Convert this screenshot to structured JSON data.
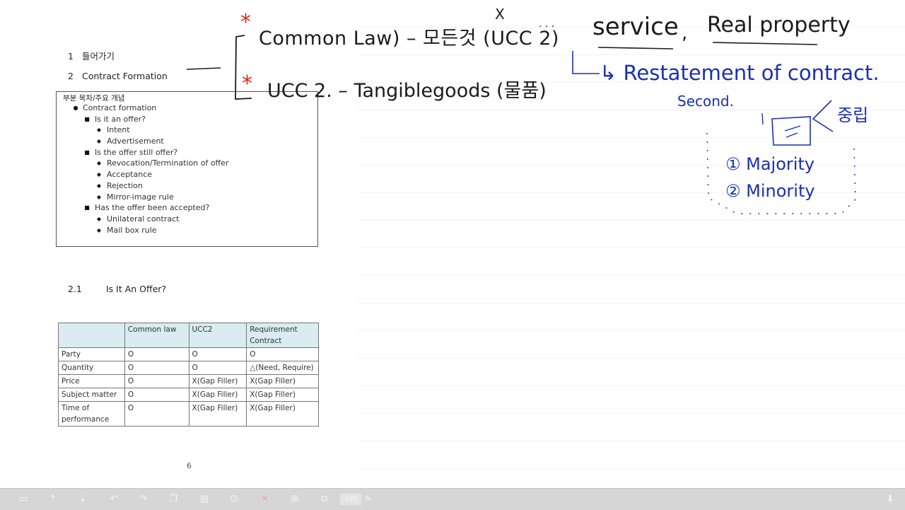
{
  "document": {
    "headings": [
      {
        "num": "1",
        "text": "들어가기"
      },
      {
        "num": "2",
        "text": "Contract Formation"
      }
    ],
    "toc": {
      "title": "부분 목차/주요 개념",
      "items": [
        {
          "level": 1,
          "text": "Contract formation"
        },
        {
          "level": 2,
          "text": "Is it an offer?"
        },
        {
          "level": 3,
          "text": "Intent"
        },
        {
          "level": 3,
          "text": "Advertisement"
        },
        {
          "level": 2,
          "text": "Is the offer still offer?"
        },
        {
          "level": 3,
          "text": "Revocation/Termination of offer"
        },
        {
          "level": 3,
          "text": "Acceptance"
        },
        {
          "level": 3,
          "text": "Rejection"
        },
        {
          "level": 3,
          "text": "Mirror-image rule"
        },
        {
          "level": 2,
          "text": "Has the offer been accepted?"
        },
        {
          "level": 3,
          "text": "Unilateral contract"
        },
        {
          "level": 3,
          "text": "Mail box rule"
        }
      ]
    },
    "section": {
      "num": "2.1",
      "title": "Is It An Offer?"
    },
    "table": {
      "headers": [
        "",
        "Common law",
        "UCC2",
        "Requirement Contract"
      ],
      "rows": [
        [
          "Party",
          "O",
          "O",
          "O"
        ],
        [
          "Quantity",
          "O",
          "O",
          "△(Need, Require)"
        ],
        [
          "Price",
          "O",
          "X(Gap Filler)",
          "X(Gap Filler)"
        ],
        [
          "Subject matter",
          "O",
          "X(Gap Filler)",
          "X(Gap Filler)"
        ],
        [
          "Time of performance",
          "O",
          "X(Gap Filler)",
          "X(Gap Filler)"
        ]
      ]
    },
    "page_number": "6"
  },
  "annotations": {
    "asterisk1": "*",
    "asterisk2": "*",
    "line1": "Common Law) – 모든것 (UCC 2)",
    "line1_x": "X",
    "line1_dots": "· · ·",
    "service": "service",
    "comma": ",",
    "real_property": "Real property",
    "line2": "UCC 2. – Tangiblegoods (물품)",
    "restatement": "↳ Restatement of contract.",
    "second": "Second.",
    "korean": "중립",
    "majority": "① Majority",
    "minority": "② Minority"
  },
  "toolbar": {
    "zoom_value": "100",
    "zoom_unit": "%"
  },
  "colors": {
    "ink_black": "#1b1b1b",
    "ink_blue": "#1a2fb5",
    "ink_red": "#e0261c",
    "table_header": "#d8ecf1",
    "toolbar_bg": "#d6d6d6"
  }
}
